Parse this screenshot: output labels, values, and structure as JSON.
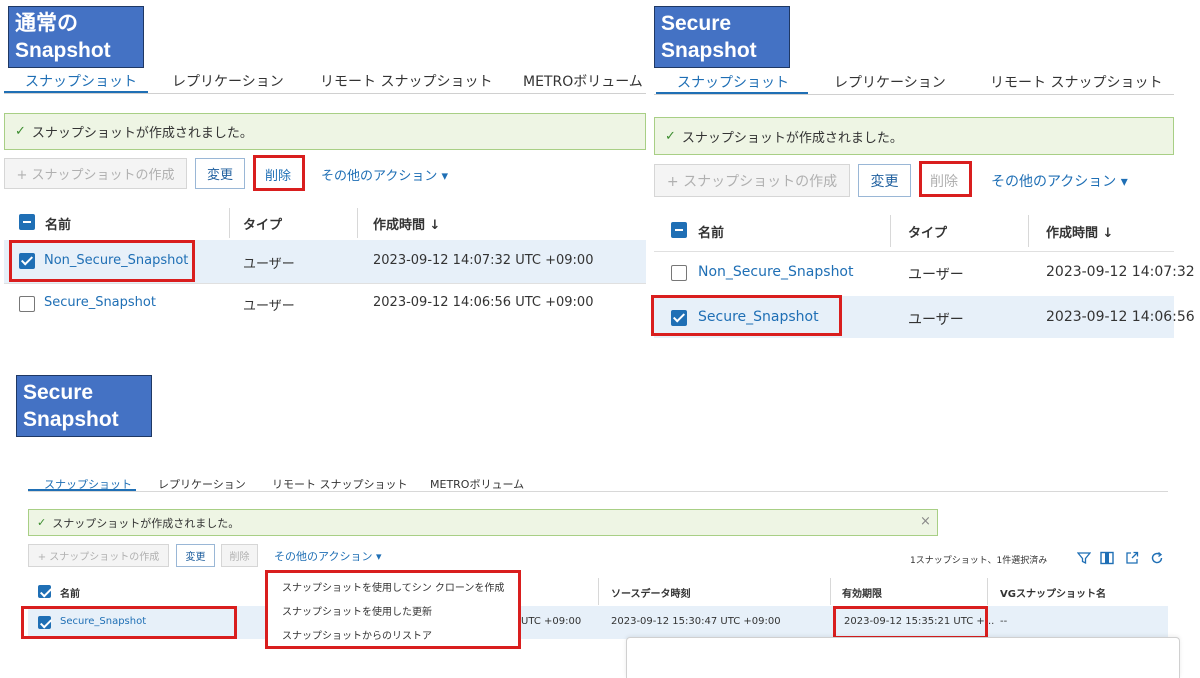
{
  "tabs": [
    "スナップショット",
    "レプリケーション",
    "リモート スナップショット",
    "METROボリューム"
  ],
  "alert_message": "スナップショットが作成されました。",
  "buttons": {
    "create": "+ スナップショットの作成",
    "change": "変更",
    "delete": "削除",
    "other_actions": "その他のアクション ▾"
  },
  "panel1": {
    "title_line1": "通常の",
    "title_line2": "Snapshot",
    "columns": [
      "名前",
      "タイプ",
      "作成時間 ↓"
    ],
    "rows": [
      {
        "name": "Non_Secure_Snapshot",
        "type": "ユーザー",
        "created": "2023-09-12 14:07:32 UTC +09:00",
        "checked": true
      },
      {
        "name": "Secure_Snapshot",
        "type": "ユーザー",
        "created": "2023-09-12 14:06:56 UTC +09:00",
        "checked": false
      }
    ]
  },
  "panel2": {
    "title_line1": "Secure",
    "title_line2": "Snapshot",
    "columns": [
      "名前",
      "タイプ",
      "作成時間 ↓"
    ],
    "rows": [
      {
        "name": "Non_Secure_Snapshot",
        "type": "ユーザー",
        "created": "2023-09-12 14:07:32",
        "checked": false
      },
      {
        "name": "Secure_Snapshot",
        "type": "ユーザー",
        "created": "2023-09-12 14:06:56",
        "checked": true
      }
    ]
  },
  "panel3": {
    "title_line1": "Secure",
    "title_line2": "Snapshot",
    "selection_count": "1スナップショット、1件選択済み",
    "columns": {
      "name": "名前",
      "source_time": "ソースデータ時刻",
      "expiry": "有効期限",
      "vg_name": "VGスナップショット名"
    },
    "row": {
      "name": "Secure_Snapshot",
      "created_partial": "UTC +09:00",
      "source_time": "2023-09-12 15:30:47 UTC +09:00",
      "expiry": "2023-09-12 15:35:21 UTC +...",
      "vg_name": "--"
    },
    "menu_items": [
      "スナップショットを使用してシン クローンを作成",
      "スナップショットを使用した更新",
      "スナップショットからのリストア"
    ],
    "close_symbol": "×"
  },
  "icons": [
    "check-icon",
    "filter-icon",
    "columns-icon",
    "export-icon",
    "refresh-icon",
    "close-icon"
  ],
  "colors": {
    "accent": "#1f6fb5",
    "title_box": "#4472c4",
    "highlight": "#d91e1e",
    "alert_bg": "#eef5e4",
    "selected_row": "#e7f0f9"
  }
}
